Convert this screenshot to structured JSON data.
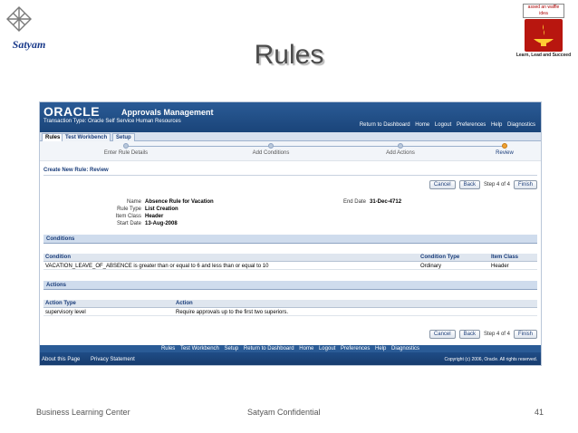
{
  "slide": {
    "title": "Rules",
    "satyam_logo": "Satyam",
    "blc_logo_top": "assed an waffle idea",
    "blc_logo_caption": "Learn, Lead and Succeed",
    "footer_left": "Business Learning Center",
    "footer_center": "Satyam Confidential",
    "footer_page": "41"
  },
  "app": {
    "oracle": "ORACLE",
    "name": "Approvals Management",
    "transaction_type": "Transaction Type: Oracle Self Service Human Resources",
    "global_links": [
      "Return to Dashboard",
      "Home",
      "Logout",
      "Preferences",
      "Help",
      "Diagnostics"
    ]
  },
  "tabs": [
    "Rules",
    "Test Workbench",
    "Setup"
  ],
  "train": [
    {
      "label": "Enter Rule Details",
      "current": false
    },
    {
      "label": "Add Conditions",
      "current": false
    },
    {
      "label": "Add Actions",
      "current": false
    },
    {
      "label": "Review",
      "current": true
    }
  ],
  "page_title": "Create New Rule: Review",
  "buttons": {
    "cancel": "Cancel",
    "back": "Back",
    "step_of": "Step 4 of 4",
    "finish": "Finish"
  },
  "rule": {
    "name_label": "Name",
    "name": "Absence Rule for Vacation",
    "type_label": "Rule Type",
    "type": "List Creation",
    "item_class_label": "Item Class",
    "item_class": "Header",
    "start_label": "Start Date",
    "start": "13-Aug-2008",
    "end_label": "End Date",
    "end": "31-Dec-4712"
  },
  "conditions": {
    "section": "Conditions",
    "columns": [
      "Condition",
      "Condition Type",
      "Item Class"
    ],
    "rows": [
      [
        "VACATION_LEAVE_OF_ABSENCE is greater than or equal to 6 and less than or equal to 10",
        "Ordinary",
        "Header"
      ]
    ]
  },
  "actions": {
    "section": "Actions",
    "columns": [
      "Action Type",
      "Action"
    ],
    "rows": [
      [
        "supervisory level",
        "Require approvals up to the first two superiors."
      ]
    ]
  },
  "bottom_links": [
    "Rules",
    "Test Workbench",
    "Setup",
    "Return to Dashboard",
    "Home",
    "Logout",
    "Preferences",
    "Help",
    "Diagnostics"
  ],
  "footer": {
    "about": "About this Page",
    "privacy": "Privacy Statement",
    "copyright": "Copyright (c) 2006, Oracle. All rights reserved."
  }
}
